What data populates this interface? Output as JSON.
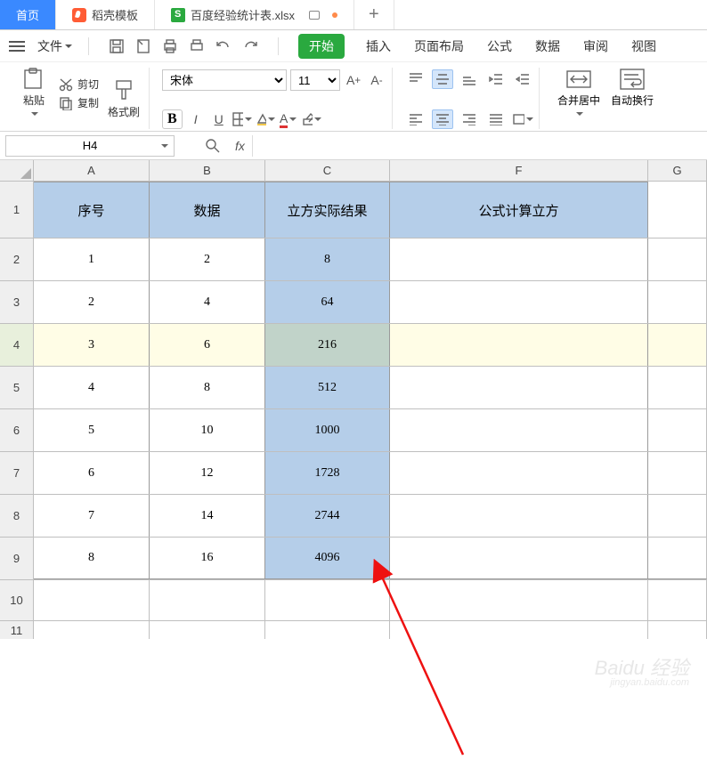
{
  "tabs": {
    "home": "首页",
    "dk": "稻壳模板",
    "file": "百度经验统计表.xlsx",
    "add": "+"
  },
  "menubar": {
    "file": "文件"
  },
  "ribbontabs": {
    "start": "开始",
    "insert": "插入",
    "layout": "页面布局",
    "formula": "公式",
    "data": "数据",
    "review": "审阅",
    "view": "视图"
  },
  "ribbon": {
    "paste": "粘贴",
    "cut": "剪切",
    "copy": "复制",
    "format_painter": "格式刷",
    "merge_center": "合并居中",
    "auto_wrap": "自动换行",
    "font_name": "宋体",
    "font_size": "11"
  },
  "namebox": "H4",
  "fx_label": "fx",
  "sheet": {
    "columns": {
      "A": "A",
      "B": "B",
      "C": "C",
      "F": "F",
      "G": "G"
    },
    "headers": {
      "A": "序号",
      "B": "数据",
      "C": "立方实际结果",
      "F": "公式计算立方"
    },
    "rows": [
      {
        "n": "1"
      },
      {
        "n": "2",
        "A": "1",
        "B": "2",
        "C": "8"
      },
      {
        "n": "3",
        "A": "2",
        "B": "4",
        "C": "64"
      },
      {
        "n": "4",
        "A": "3",
        "B": "6",
        "C": "216"
      },
      {
        "n": "5",
        "A": "4",
        "B": "8",
        "C": "512"
      },
      {
        "n": "6",
        "A": "5",
        "B": "10",
        "C": "1000"
      },
      {
        "n": "7",
        "A": "6",
        "B": "12",
        "C": "1728"
      },
      {
        "n": "8",
        "A": "7",
        "B": "14",
        "C": "2744"
      },
      {
        "n": "9",
        "A": "8",
        "B": "16",
        "C": "4096"
      },
      {
        "n": "10"
      },
      {
        "n": "11"
      }
    ]
  },
  "watermark": {
    "main": "Baidu 经验",
    "sub": "jingyan.baidu.com"
  }
}
